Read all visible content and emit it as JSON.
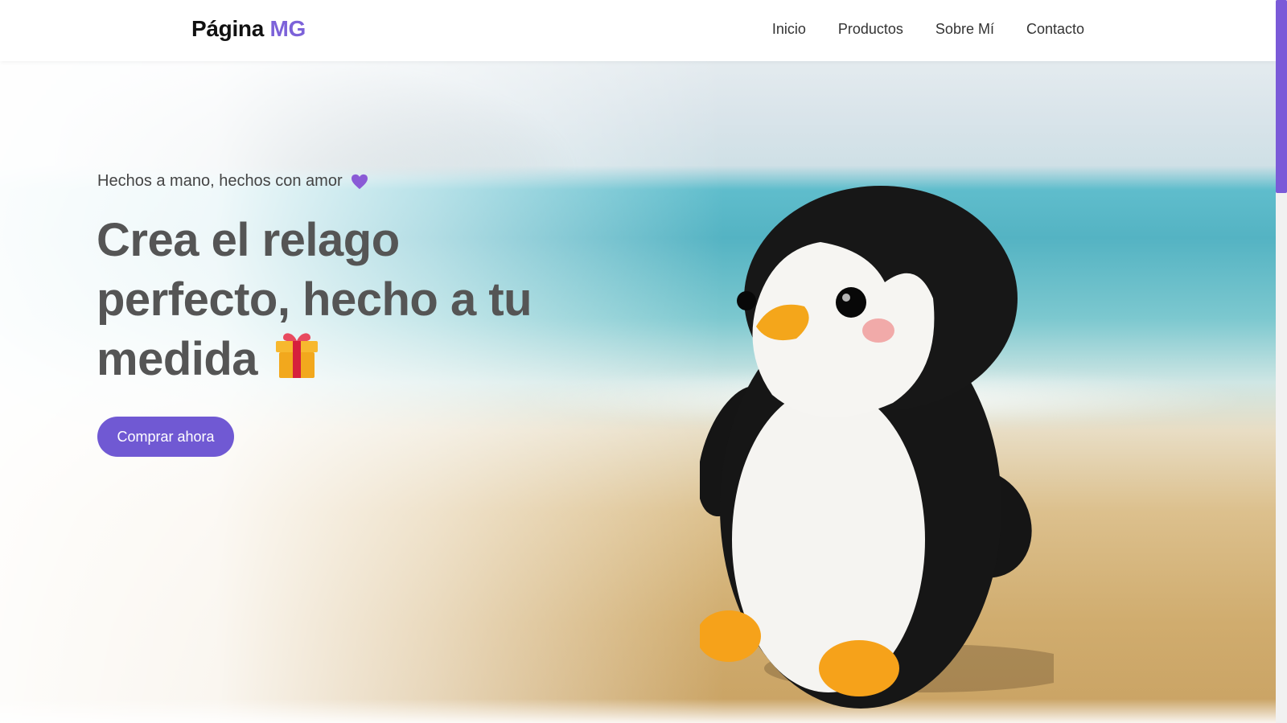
{
  "header": {
    "logo_main": "Página",
    "logo_accent": "MG",
    "nav": [
      {
        "label": "Inicio"
      },
      {
        "label": "Productos"
      },
      {
        "label": "Sobre Mí"
      },
      {
        "label": "Contacto"
      }
    ]
  },
  "hero": {
    "tagline": "Hechos a mano, hechos con amor",
    "tagline_icon": "purple-heart-icon",
    "headline_line1": "Crea el relago",
    "headline_line2": "perfecto, hecho a tu",
    "headline_line3": "medida",
    "headline_icon": "gift-icon",
    "cta_label": "Comprar ahora",
    "image_subject": "penguin-plush-icon"
  },
  "colors": {
    "accent": "#7c62d9",
    "button": "#7059d3",
    "heading": "#555555",
    "scrollbar_thumb": "#7a5ad8"
  }
}
